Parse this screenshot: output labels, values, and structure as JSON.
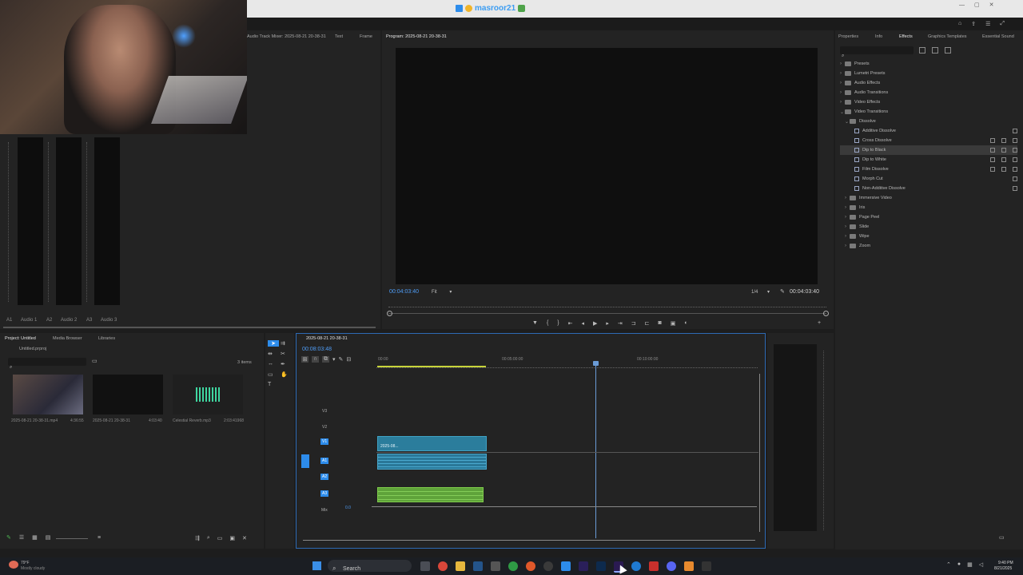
{
  "window": {
    "bg": "#1d1d1d",
    "accent": "#2d8ceb"
  },
  "chat": {
    "lines": [
      {
        "name": "masroor21"
      },
      {
        "name": "masroor21"
      },
      {
        "name": "masroor21"
      },
      {
        "name": "masroor21"
      }
    ]
  },
  "source_panel": {
    "tab_track_mixer": "Audio Track Mixer: 2025-08-21 20-38-31",
    "tab_text": "Text",
    "tab_frame": "Frame"
  },
  "meters": {
    "labels": [
      "A1",
      "Audio 1",
      "A2",
      "Audio 2",
      "A3",
      "Audio 3"
    ]
  },
  "program": {
    "title": "Program: 2025-08-21 20-38-31",
    "timecode_left": "00:04:03:40",
    "fit": "Fit",
    "ratio": "1/4",
    "timecode_right": "00:04:03:40"
  },
  "effects_panel": {
    "tabs": [
      "Properties",
      "Info",
      "Effects",
      "Graphics Templates",
      "Essential Sound"
    ],
    "tree": [
      {
        "label": "Presets",
        "level": 0,
        "type": "folder"
      },
      {
        "label": "Lumetri Presets",
        "level": 0,
        "type": "folder"
      },
      {
        "label": "Audio Effects",
        "level": 0,
        "type": "folder"
      },
      {
        "label": "Audio Transitions",
        "level": 0,
        "type": "folder"
      },
      {
        "label": "Video Effects",
        "level": 0,
        "type": "folder"
      },
      {
        "label": "Video Transitions",
        "level": 0,
        "type": "folder",
        "open": true
      },
      {
        "label": "Dissolve",
        "level": 1,
        "type": "folder",
        "open": true
      },
      {
        "label": "Additive Dissolve",
        "level": 2,
        "type": "fx"
      },
      {
        "label": "Cross Dissolve",
        "level": 2,
        "type": "fx"
      },
      {
        "label": "Dip to Black",
        "level": 2,
        "type": "fx",
        "selected": true
      },
      {
        "label": "Dip to White",
        "level": 2,
        "type": "fx"
      },
      {
        "label": "Film Dissolve",
        "level": 2,
        "type": "fx"
      },
      {
        "label": "Morph Cut",
        "level": 2,
        "type": "fx"
      },
      {
        "label": "Non-Additive Dissolve",
        "level": 2,
        "type": "fx"
      },
      {
        "label": "Immersive Video",
        "level": 1,
        "type": "folder"
      },
      {
        "label": "Iris",
        "level": 1,
        "type": "folder"
      },
      {
        "label": "Page Peel",
        "level": 1,
        "type": "folder"
      },
      {
        "label": "Slide",
        "level": 1,
        "type": "folder"
      },
      {
        "label": "Wipe",
        "level": 1,
        "type": "folder"
      },
      {
        "label": "Zoom",
        "level": 1,
        "type": "folder"
      }
    ]
  },
  "project": {
    "tabs": [
      "Project: Untitled",
      "Media Browser",
      "Libraries"
    ],
    "file": "Untitled.prproj",
    "items_count": "3 items",
    "items": [
      {
        "name": "2025-08-21 20-38-31.mp4",
        "duration": "4:36:55"
      },
      {
        "name": "2025-08-21 20-38-31",
        "duration": "4:03:40"
      },
      {
        "name": "Celestial Reverb.mp3",
        "duration": "2:03:41968"
      }
    ]
  },
  "timeline": {
    "title": "2025-08-21 20-38-31",
    "timecode": "00:08:03:48",
    "ruler": [
      "00:00",
      "00:05:00:00",
      "00:10:00:00"
    ],
    "tracks": [
      "V3",
      "V2",
      "V1",
      "A1",
      "A2",
      "A3",
      "Mix"
    ],
    "mix_value": "0.0",
    "clip_label": "2025-08..."
  },
  "taskbar": {
    "weather_temp": "79°F",
    "weather_desc": "Mostly cloudy",
    "search": "Search",
    "time": "9:40 PM",
    "date": "8/21/2025"
  }
}
